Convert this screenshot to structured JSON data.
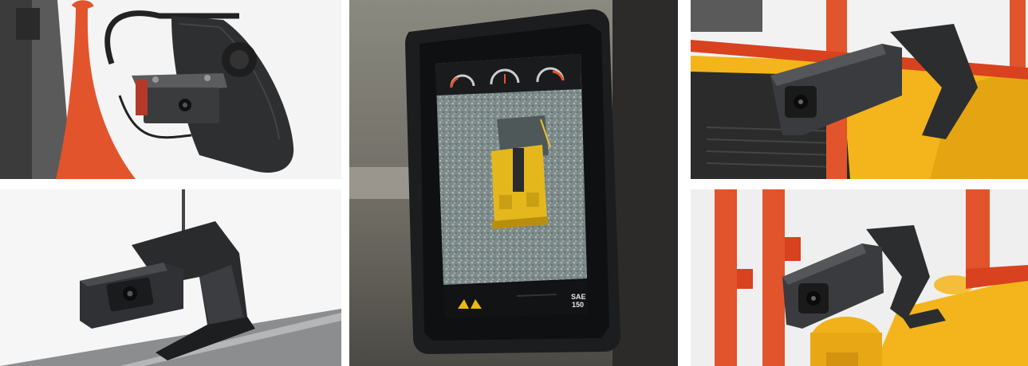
{
  "gallery": {
    "panels": [
      {
        "name": "mirror-bracket-camera"
      },
      {
        "name": "camera-bracket-closeup"
      },
      {
        "name": "monitor-display"
      },
      {
        "name": "camera-on-yellow-cab"
      },
      {
        "name": "camera-near-rails"
      }
    ]
  },
  "monitor": {
    "sae_line1": "SAE",
    "sae_line2": "150",
    "gauges": 3,
    "icon": "hand-warning-icon"
  },
  "colors": {
    "rail_orange": "#e2542b",
    "machine_yellow": "#f3b51b",
    "camera_black": "#2a2b2d",
    "screen_bezel": "#1c1d1f"
  }
}
